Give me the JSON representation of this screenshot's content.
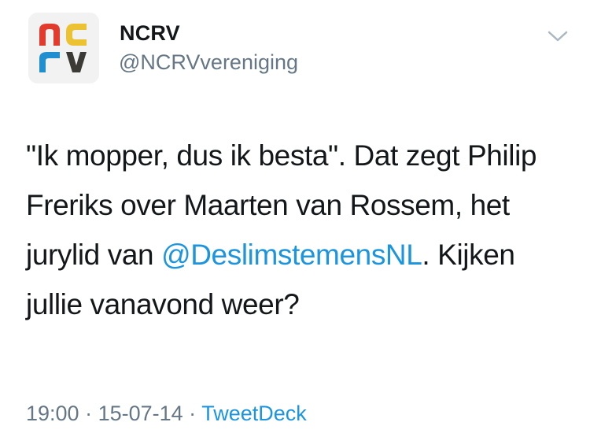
{
  "account": {
    "display_name": "NCRV",
    "handle": "@NCRVvereniging",
    "avatar": {
      "icon": "ncrv-logo-icon",
      "text": "NCRV",
      "colors": [
        "#e23b2e",
        "#1f8fcf",
        "#ecc132",
        "#3b3a36"
      ]
    }
  },
  "menu": {
    "icon": "chevron-down-icon"
  },
  "tweet": {
    "text_before": "\"Ik mopper, dus ik besta\". Dat zegt Philip Freriks over Maarten van Rossem, het jurylid van ",
    "mention": "@DeslimstemensNL",
    "text_after": ". Kijken jullie vanavond weer?"
  },
  "meta": {
    "time": "19:00",
    "sep1": " · ",
    "date": "15-07-14",
    "sep2": " · ",
    "source": "TweetDeck"
  },
  "colors": {
    "link": "#1b95e0",
    "secondary_text": "#657786",
    "primary_text": "#14171a"
  }
}
